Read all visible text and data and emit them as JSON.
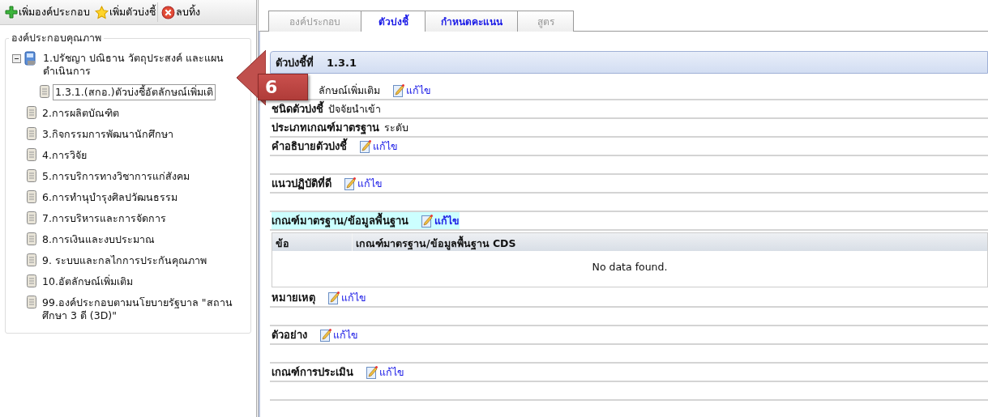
{
  "toolbar": [
    {
      "kind": "add",
      "label": "เพิ่มองค์ประกอบ"
    },
    {
      "kind": "star",
      "label": "เพิ่มตัวบ่งชี้"
    },
    {
      "kind": "delete",
      "label": "ลบทิ้ง"
    }
  ],
  "tree": {
    "title": "องค์ประกอบคุณภาพ",
    "items": [
      {
        "label": "1.ปรัชญา ปณิธาน วัตถุประสงค์ และแผนดำเนินการ",
        "expanded": true,
        "selected": false,
        "children": [
          {
            "label": "1.3.1.(สกอ.)ตัวบ่งชี้อัตลักษณ์เพิ่มเติ",
            "selected": true
          }
        ]
      },
      {
        "label": "2.การผลิตบัณฑิต",
        "selected": false
      },
      {
        "label": "3.กิจกรรมการพัฒนานักศึกษา",
        "selected": false
      },
      {
        "label": "4.การวิจัย",
        "selected": false
      },
      {
        "label": "5.การบริการทางวิชาการแก่สังคม",
        "selected": false
      },
      {
        "label": "6.การทำนุบำรุงศิลปวัฒนธรรม",
        "selected": false
      },
      {
        "label": "7.การบริหารและการจัดการ",
        "selected": false
      },
      {
        "label": "8.การเงินและงบประมาณ",
        "selected": false
      },
      {
        "label": "9. ระบบและกลไกการประกันคุณภาพ",
        "selected": false
      },
      {
        "label": "10.อัตลักษณ์เพิ่มเติม",
        "selected": false
      },
      {
        "label": "99.องค์ประกอบตามนโยบายรัฐบาล \"สถานศึกษา 3 ดี (3D)\"",
        "selected": false
      }
    ]
  },
  "tabs": [
    {
      "label": "องค์ประกอบ",
      "selected": false,
      "disabled": true
    },
    {
      "label": "ตัวบ่งชี้",
      "selected": true,
      "disabled": false
    },
    {
      "label": "กำหนดคะแนน",
      "selected": false,
      "disabled": false
    },
    {
      "label": "สูตร",
      "selected": false,
      "disabled": true
    }
  ],
  "indicator": {
    "heading": "ตัวบ่งชี้ที่",
    "number": "1.3.1"
  },
  "rows": [
    {
      "kind": "field",
      "value": "ลักษณ์เพิ่มเติม",
      "edit": "แก้ไข",
      "highlighted": false
    },
    {
      "kind": "field",
      "label": "ชนิดตัวบ่งชี้",
      "value": "ปัจจัยนำเข้า",
      "highlighted": false
    },
    {
      "kind": "field",
      "label": "ประเภทเกณฑ์มาตรฐาน",
      "value": "ระดับ",
      "highlighted": false
    },
    {
      "kind": "field",
      "label": "คำอธิบายตัวบ่งชี้",
      "edit": "แก้ไข",
      "highlighted": false
    },
    {
      "kind": "blank"
    },
    {
      "kind": "field",
      "label": "แนวปฏิบัติที่ดี",
      "edit": "แก้ไข",
      "highlighted": false
    },
    {
      "kind": "blank"
    },
    {
      "kind": "field",
      "label": "เกณฑ์มาตรฐาน/ข้อมูลพื้นฐาน",
      "edit": "แก้ไข",
      "highlighted": true
    },
    {
      "kind": "table",
      "columns": [
        "ข้อ",
        "เกณฑ์มาตรฐาน/ข้อมูลพื้นฐาน CDS"
      ],
      "empty": "No data found."
    },
    {
      "kind": "field",
      "label": "หมายเหตุ",
      "edit": "แก้ไข",
      "highlighted": false
    },
    {
      "kind": "blank"
    },
    {
      "kind": "field",
      "label": "ตัวอย่าง",
      "edit": "แก้ไข",
      "highlighted": false
    },
    {
      "kind": "blank"
    },
    {
      "kind": "field",
      "label": "เกณฑ์การประเมิน",
      "edit": "แก้ไข",
      "highlighted": false
    },
    {
      "kind": "blank"
    }
  ],
  "callout": {
    "text": "6"
  }
}
